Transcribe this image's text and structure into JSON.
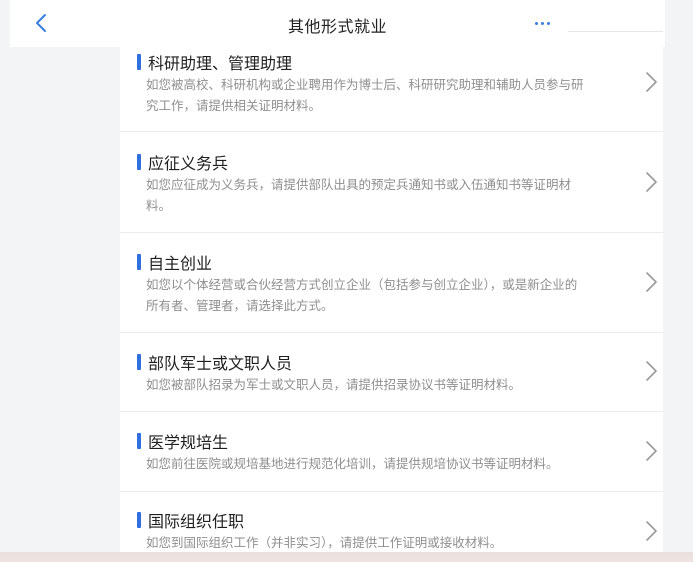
{
  "nav": {
    "title": "其他形式就业",
    "back_icon": "chevron-left-icon",
    "more_icon": "ellipsis-icon",
    "accent": "#3a7de0"
  },
  "items": [
    {
      "title": "科研助理、管理助理",
      "desc_lines": [
        "如您被高校、科研机构或企业聘用作为博士后、科研研究助理和辅助人员参与研",
        "究工作，请提供相关证明材料。"
      ]
    },
    {
      "title": "应征义务兵",
      "desc_lines": [
        "如您应征成为义务兵，请提供部队出具的预定兵通知书或入伍通知书等证明材",
        "料。"
      ]
    },
    {
      "title": "自主创业",
      "desc_lines": [
        "如您以个体经营或合伙经营方式创立企业（包括参与创立企业），或是新企业的",
        "所有者、管理者，请选择此方式。"
      ]
    },
    {
      "title": "部队军士或文职人员",
      "desc_lines": [
        "如您被部队招录为军士或文职人员，请提供招录协议书等证明材料。"
      ]
    },
    {
      "title": "医学规培生",
      "desc_lines": [
        "如您前往医院或规培基地进行规范化培训，请提供规培协议书等证明材料。"
      ]
    },
    {
      "title": "国际组织任职",
      "desc_lines": [
        "如您到国际组织工作（并非实习），请提供工作证明或接收材料。"
      ]
    }
  ],
  "colors": {
    "title_marker": "#2f6fe0",
    "desc_text": "#8f8f8f",
    "chevron": "#9a9a9a"
  }
}
